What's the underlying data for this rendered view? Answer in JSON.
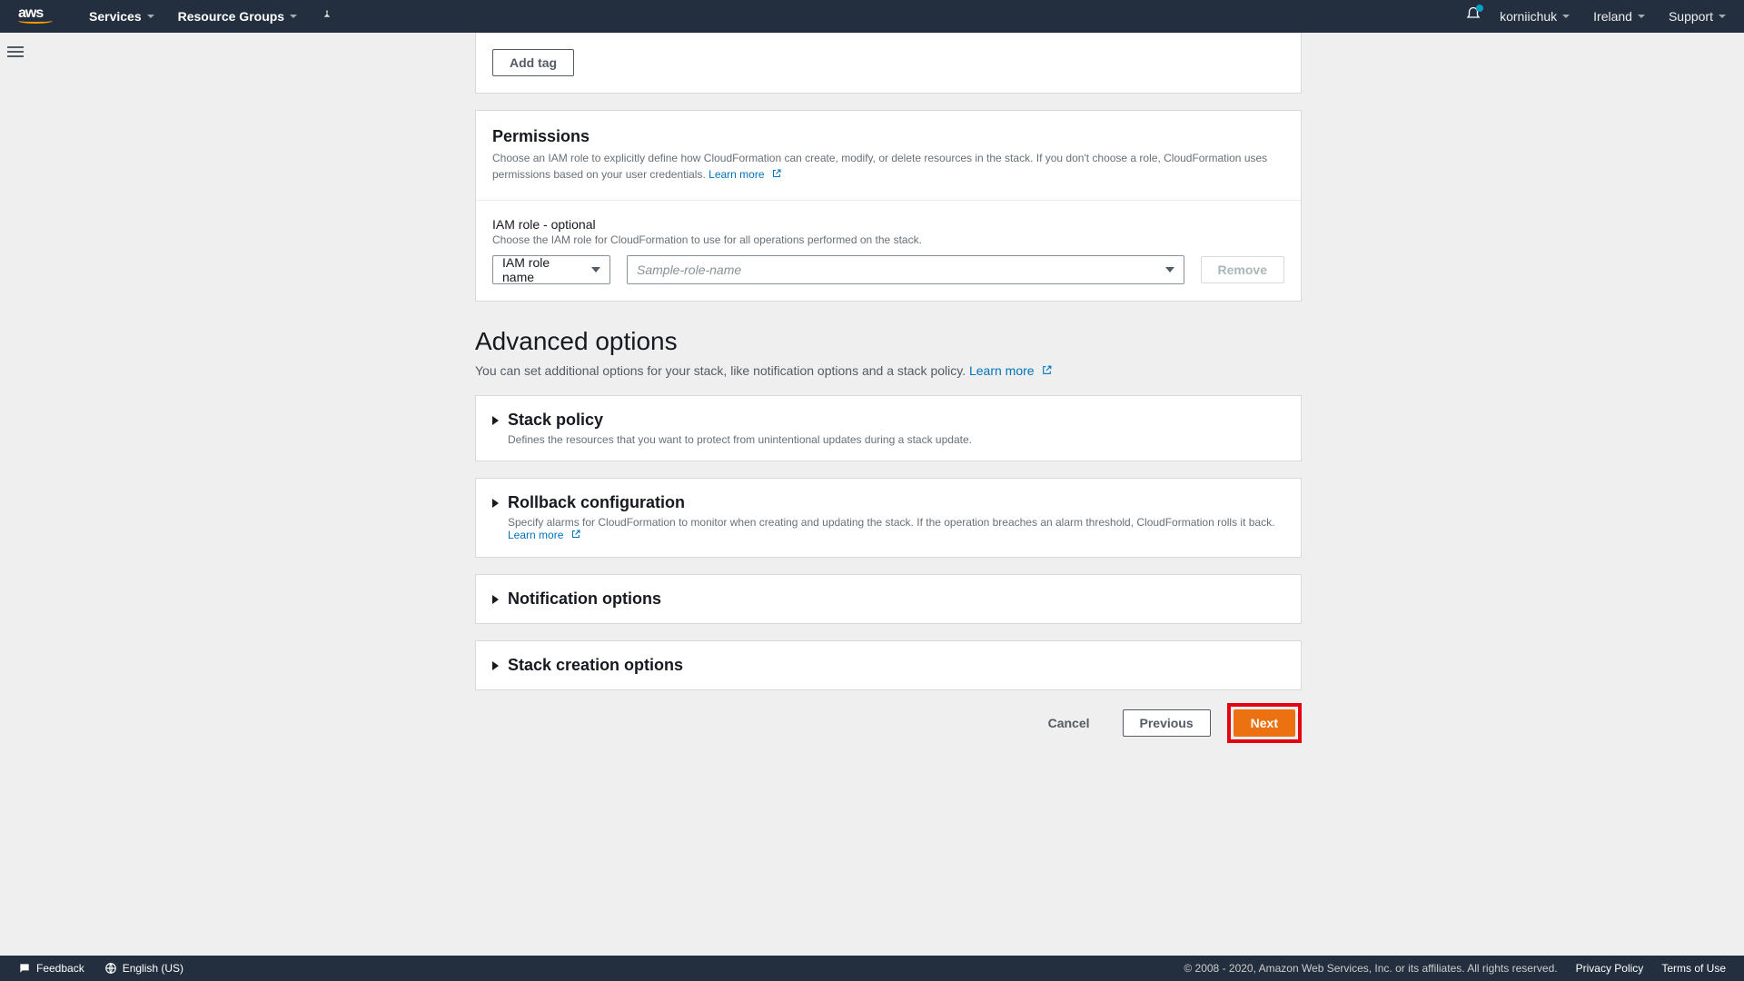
{
  "nav": {
    "services": "Services",
    "resource_groups": "Resource Groups",
    "user": "korniichuk",
    "region": "Ireland",
    "support": "Support"
  },
  "tags_card": {
    "add_tag": "Add tag"
  },
  "permissions_card": {
    "title": "Permissions",
    "desc1": "Choose an IAM role to explicitly define how CloudFormation can create, modify, or delete resources in the stack. If you don't choose a role, CloudFormation uses permissions based on your user credentials.",
    "learn_more": "Learn more",
    "iam_label": "IAM role - optional",
    "iam_hint": "Choose the IAM role for CloudFormation to use for all operations performed on the stack.",
    "iam_select": "IAM role name",
    "iam_placeholder": "Sample-role-name",
    "remove": "Remove"
  },
  "advanced": {
    "title": "Advanced options",
    "sub": "You can set additional options for your stack, like notification options and a stack policy.",
    "learn_more": "Learn more"
  },
  "expanders": {
    "stack_policy": {
      "title": "Stack policy",
      "desc": "Defines the resources that you want to protect from unintentional updates during a stack update."
    },
    "rollback": {
      "title": "Rollback configuration",
      "desc": "Specify alarms for CloudFormation to monitor when creating and updating the stack. If the operation breaches an alarm threshold, CloudFormation rolls it back.",
      "learn_more": "Learn more"
    },
    "notification": {
      "title": "Notification options"
    },
    "creation": {
      "title": "Stack creation options"
    }
  },
  "actions": {
    "cancel": "Cancel",
    "previous": "Previous",
    "next": "Next"
  },
  "footer": {
    "feedback": "Feedback",
    "language": "English (US)",
    "copyright": "© 2008 - 2020, Amazon Web Services, Inc. or its affiliates. All rights reserved.",
    "privacy": "Privacy Policy",
    "terms": "Terms of Use"
  }
}
